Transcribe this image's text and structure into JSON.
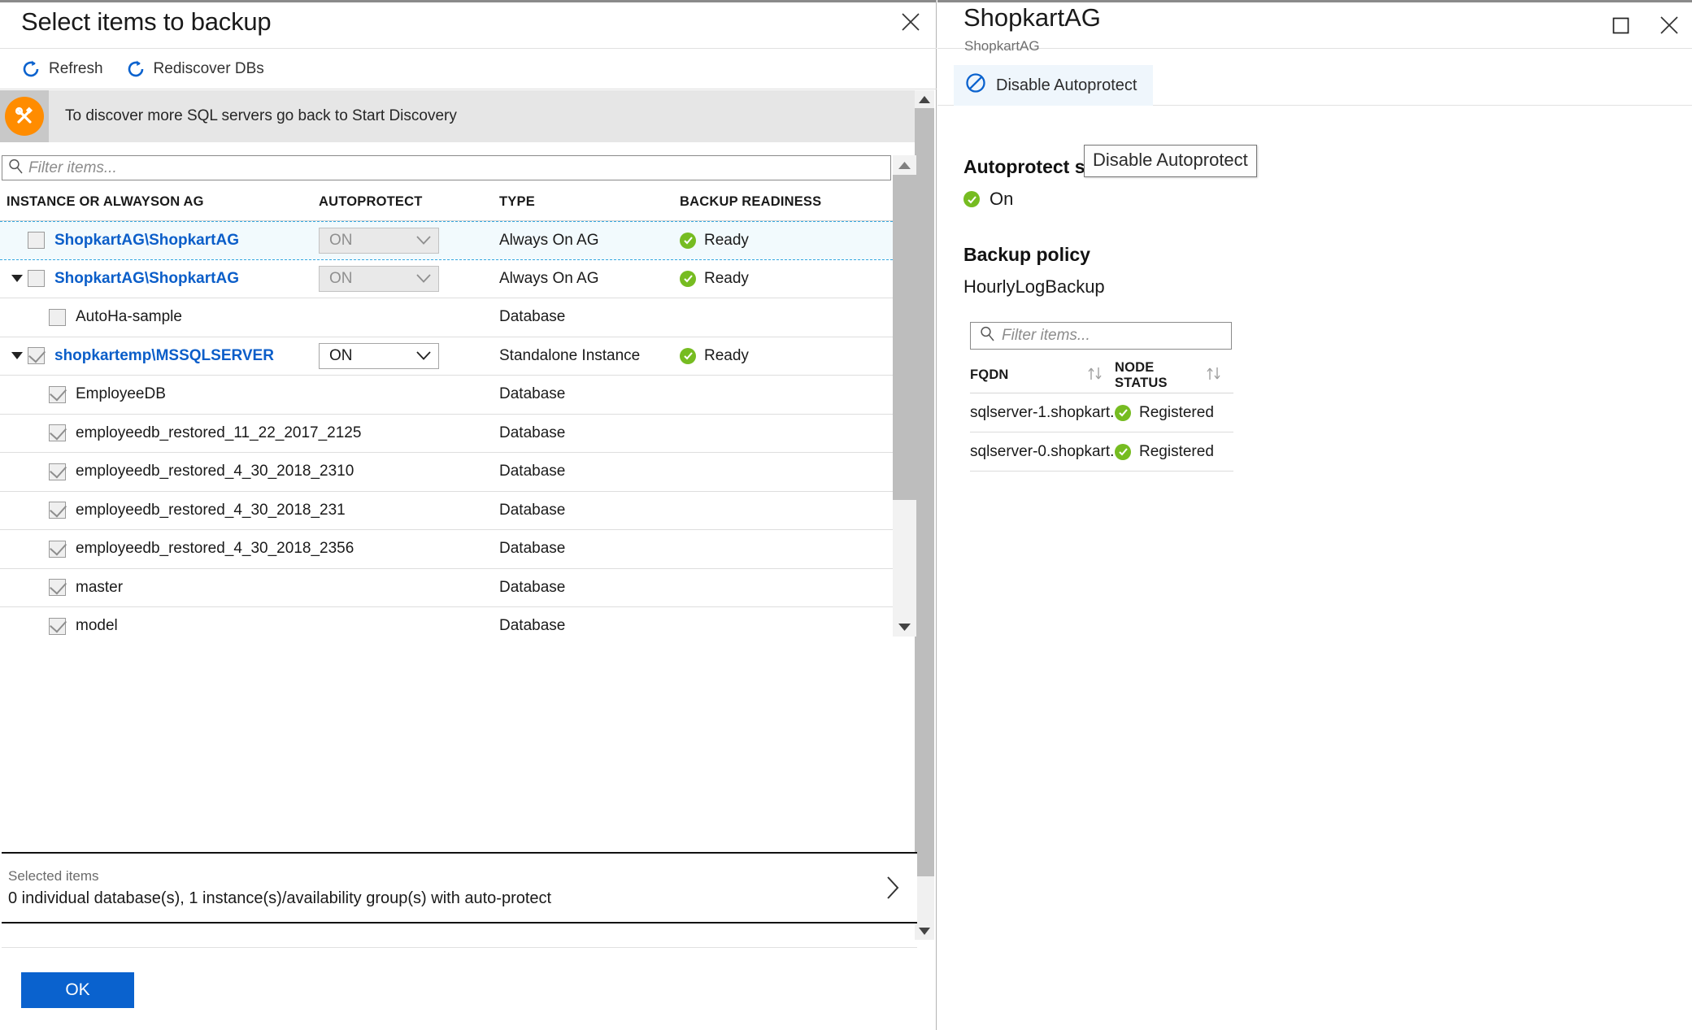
{
  "left_blade": {
    "title": "Select items to backup",
    "close_icon": "close-icon",
    "commands": [
      {
        "label": "Refresh",
        "icon": "refresh-icon"
      },
      {
        "label": "Rediscover DBs",
        "icon": "refresh-icon"
      }
    ],
    "notice": {
      "icon": "tools-icon",
      "text": "To discover more SQL servers go back to Start Discovery"
    },
    "filter": {
      "placeholder": "Filter items...",
      "value": "",
      "icon": "search-icon"
    },
    "grid": {
      "columns": [
        "INSTANCE OR ALWAYSON AG",
        "AUTOPROTECT",
        "TYPE",
        "BACKUP READINESS"
      ],
      "rows": [
        {
          "name": "ShopkartAG\\ShopkartAG",
          "is_link": true,
          "indent": 0,
          "twisty": "",
          "checked": false,
          "autoprotect": "ON",
          "autoprotect_disabled": true,
          "type": "Always On AG",
          "readiness": "Ready",
          "selected": true
        },
        {
          "name": "ShopkartAG\\ShopkartAG",
          "is_link": true,
          "indent": 0,
          "twisty": "expanded",
          "checked": false,
          "autoprotect": "ON",
          "autoprotect_disabled": true,
          "type": "Always On AG",
          "readiness": "Ready",
          "selected": false
        },
        {
          "name": "AutoHa-sample",
          "is_link": false,
          "indent": 1,
          "twisty": "",
          "checked": false,
          "autoprotect": "",
          "autoprotect_disabled": false,
          "type": "Database",
          "readiness": "",
          "selected": false
        },
        {
          "name": "shopkartemp\\MSSQLSERVER",
          "is_link": true,
          "indent": 0,
          "twisty": "expanded",
          "checked": true,
          "autoprotect": "ON",
          "autoprotect_disabled": false,
          "type": "Standalone Instance",
          "readiness": "Ready",
          "selected": false
        },
        {
          "name": "EmployeeDB",
          "is_link": false,
          "indent": 1,
          "twisty": "",
          "checked": true,
          "autoprotect": "",
          "autoprotect_disabled": false,
          "type": "Database",
          "readiness": "",
          "selected": false
        },
        {
          "name": "employeedb_restored_11_22_2017_2125",
          "is_link": false,
          "indent": 1,
          "twisty": "",
          "checked": true,
          "autoprotect": "",
          "autoprotect_disabled": false,
          "type": "Database",
          "readiness": "",
          "selected": false
        },
        {
          "name": "employeedb_restored_4_30_2018_2310",
          "is_link": false,
          "indent": 1,
          "twisty": "",
          "checked": true,
          "autoprotect": "",
          "autoprotect_disabled": false,
          "type": "Database",
          "readiness": "",
          "selected": false
        },
        {
          "name": "employeedb_restored_4_30_2018_231",
          "is_link": false,
          "indent": 1,
          "twisty": "",
          "checked": true,
          "autoprotect": "",
          "autoprotect_disabled": false,
          "type": "Database",
          "readiness": "",
          "selected": false
        },
        {
          "name": "employeedb_restored_4_30_2018_2356",
          "is_link": false,
          "indent": 1,
          "twisty": "",
          "checked": true,
          "autoprotect": "",
          "autoprotect_disabled": false,
          "type": "Database",
          "readiness": "",
          "selected": false
        },
        {
          "name": "master",
          "is_link": false,
          "indent": 1,
          "twisty": "",
          "checked": true,
          "autoprotect": "",
          "autoprotect_disabled": false,
          "type": "Database",
          "readiness": "",
          "selected": false
        },
        {
          "name": "model",
          "is_link": false,
          "indent": 1,
          "twisty": "",
          "checked": true,
          "autoprotect": "",
          "autoprotect_disabled": false,
          "type": "Database",
          "readiness": "",
          "selected": false
        }
      ]
    },
    "selected_items": {
      "label": "Selected items",
      "summary": "0 individual database(s), 1 instance(s)/availability group(s) with auto-protect",
      "chevron_icon": "chevron-right-icon"
    },
    "ok_label": "OK"
  },
  "right_blade": {
    "title": "ShopkartAG",
    "subtitle": "ShopkartAG",
    "maximize_icon": "maximize-icon",
    "close_icon": "close-icon",
    "command": {
      "label": "Disable Autoprotect",
      "icon": "block-icon"
    },
    "tooltip": "Disable Autoprotect",
    "autoprotect_status_label": "Autoprotect status",
    "autoprotect_status_value": "On",
    "backup_policy_label": "Backup policy",
    "backup_policy_value": "HourlyLogBackup",
    "filter": {
      "placeholder": "Filter items...",
      "value": "",
      "icon": "search-icon"
    },
    "node_table": {
      "columns": [
        "FQDN",
        "NODE STATUS"
      ],
      "rows": [
        {
          "fqdn": "sqlserver-1.shopkart....",
          "status": "Registered"
        },
        {
          "fqdn": "sqlserver-0.shopkart....",
          "status": "Registered"
        }
      ]
    }
  },
  "colors": {
    "accent_blue": "#0a62ce",
    "link_blue": "#0b5ec9",
    "status_green": "#76bc21",
    "notice_orange": "#ff8c00",
    "selection_row": "#f2fafd",
    "command_hover": "#eff6fc"
  }
}
